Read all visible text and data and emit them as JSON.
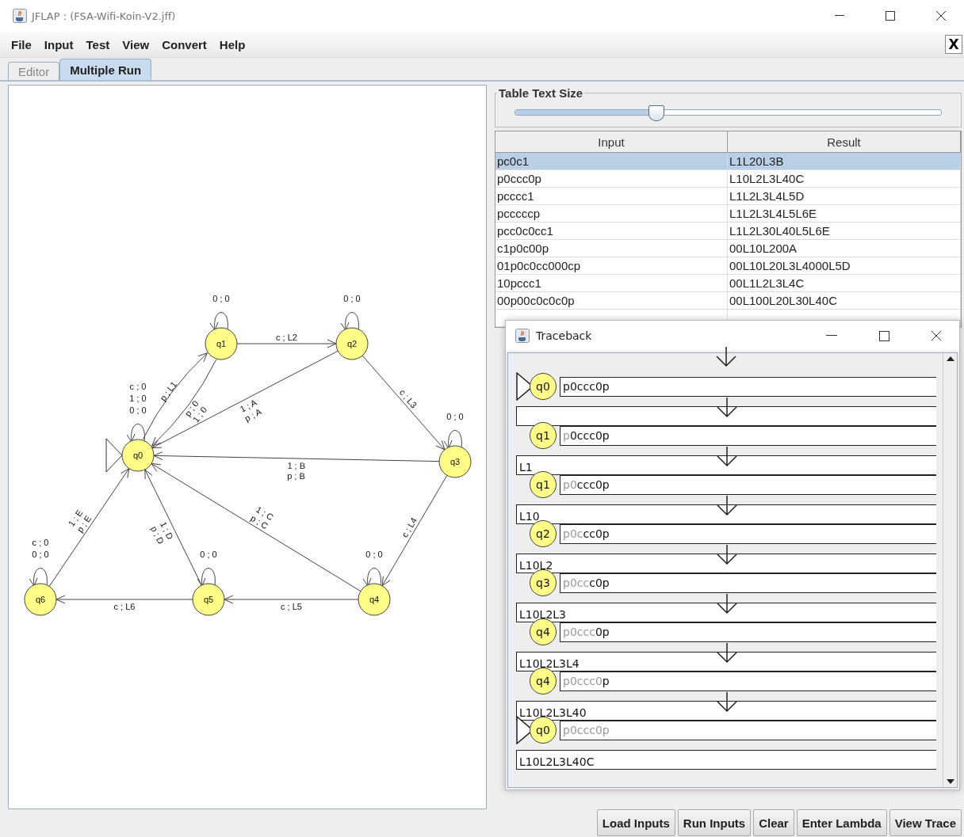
{
  "window": {
    "title": "JFLAP : (FSA-Wifi-Koin-V2.jff)"
  },
  "menu": [
    "File",
    "Input",
    "Test",
    "View",
    "Convert",
    "Help"
  ],
  "close_tab_button": "X",
  "tabs": [
    {
      "label": "Editor",
      "selected": false
    },
    {
      "label": "Multiple Run",
      "selected": true
    }
  ],
  "diagram": {
    "states": [
      {
        "name": "q1",
        "initial": false
      },
      {
        "name": "q2",
        "initial": false
      },
      {
        "name": "q0",
        "initial": true
      },
      {
        "name": "q3",
        "initial": false
      },
      {
        "name": "q6",
        "initial": false
      },
      {
        "name": "q5",
        "initial": false
      },
      {
        "name": "q4",
        "initial": false
      }
    ],
    "transitions": [
      {
        "labels": [
          "0 ; 0"
        ]
      },
      {
        "labels": [
          "0 ; 0"
        ]
      },
      {
        "labels": [
          "c ; 0",
          "1 ; 0",
          "0 ; 0"
        ]
      },
      {
        "labels": [
          "0 ; 0"
        ]
      },
      {
        "labels": [
          "c ; 0",
          "0 ; 0"
        ]
      },
      {
        "labels": [
          "0 ; 0"
        ]
      },
      {
        "labels": [
          "0 ; 0"
        ]
      },
      {
        "labels": [
          "c ; L2"
        ]
      },
      {
        "labels": [
          "p ; L1"
        ]
      },
      {
        "labels": [
          "p ; 0",
          "1 ; 0"
        ]
      },
      {
        "labels": [
          "1 ; A",
          "p ; A"
        ]
      },
      {
        "labels": [
          "c ; L3"
        ]
      },
      {
        "labels": [
          "1 ; B",
          "p ; B"
        ]
      },
      {
        "labels": [
          "1 ; E",
          "p ; E"
        ]
      },
      {
        "labels": [
          "1 ; D",
          "p ; D"
        ]
      },
      {
        "labels": [
          "1 ; C",
          "p ; C"
        ]
      },
      {
        "labels": [
          "c ; L4"
        ]
      },
      {
        "labels": [
          "c ; L6"
        ]
      },
      {
        "labels": [
          "c ; L5"
        ]
      }
    ]
  },
  "text_size": {
    "label": "Table Text Size",
    "level": 0.33
  },
  "table": {
    "columns": [
      "Input",
      "Result"
    ],
    "rows": [
      {
        "input": "pc0c1",
        "result": "L1L20L3B",
        "selected": true
      },
      {
        "input": "p0ccc0p",
        "result": "L10L2L3L40C",
        "selected": false
      },
      {
        "input": "pcccc1",
        "result": "L1L2L3L4L5D",
        "selected": false
      },
      {
        "input": "pcccccp",
        "result": "L1L2L3L4L5L6E",
        "selected": false
      },
      {
        "input": "pcc0c0cc1",
        "result": "L1L2L30L40L5L6E",
        "selected": false
      },
      {
        "input": "c1p0c00p",
        "result": "00L10L200A",
        "selected": false
      },
      {
        "input": "01p0c0cc000cp",
        "result": "00L10L20L3L4000L5D",
        "selected": false
      },
      {
        "input": "10pccc1",
        "result": "00L1L2L3L4C",
        "selected": false
      },
      {
        "input": "00p00c0c0c0p",
        "result": "00L100L20L30L40C",
        "selected": false
      }
    ]
  },
  "traceback": {
    "title": "Traceback",
    "steps": [
      {
        "state": "q0",
        "initial": true,
        "unread": "p0ccc0p"
      },
      {
        "output_box": true,
        "state": "q1",
        "initial": false,
        "read": "p",
        "unread": "0ccc0p"
      },
      {
        "output_box": true,
        "output": "L1",
        "state": "q1",
        "initial": false,
        "read": "p0",
        "unread": "ccc0p"
      },
      {
        "output_box": true,
        "output": "L10",
        "state": "q2",
        "initial": false,
        "read": "p0c",
        "unread": "cc0p"
      },
      {
        "output_box": true,
        "output": "L10L2",
        "state": "q3",
        "initial": false,
        "read": "p0cc",
        "unread": "c0p"
      },
      {
        "output_box": true,
        "output": "L10L2L3",
        "state": "q4",
        "initial": false,
        "read": "p0ccc",
        "unread": "0p"
      },
      {
        "output_box": true,
        "output": "L10L2L3L4",
        "state": "q4",
        "initial": false,
        "read": "p0ccc0",
        "unread": "p"
      },
      {
        "output_box": true,
        "output": "L10L2L3L40",
        "state": "q0",
        "initial": true,
        "read": "p0ccc0p"
      }
    ],
    "final_output": "L10L2L3L40C"
  },
  "buttons": [
    "Load Inputs",
    "Run Inputs",
    "Clear",
    "Enter Lambda",
    "View Trace"
  ]
}
